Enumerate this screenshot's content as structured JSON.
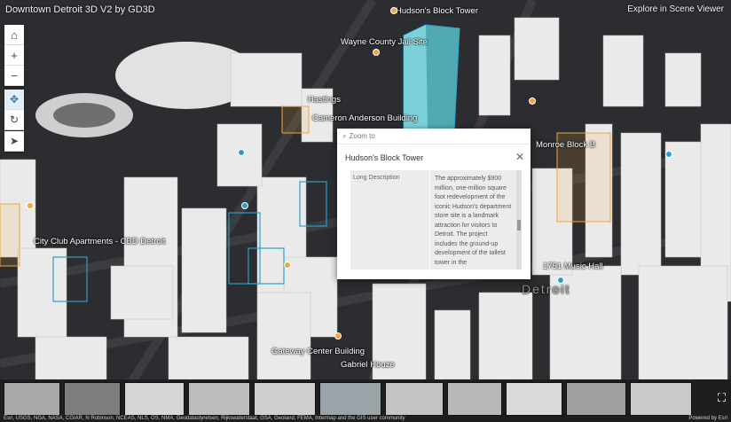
{
  "app": {
    "title": "Downtown Detroit 3D V2 by GD3D",
    "explore_link": "Explore in Scene Viewer"
  },
  "navigation": {
    "home_icon": "home-icon",
    "zoom_in": "+",
    "zoom_out": "−",
    "pan_icon": "pan-icon",
    "rotate_icon": "rotate-icon",
    "compass_icon": "compass-icon"
  },
  "map_labels": {
    "l1": "Hudson's Block Tower",
    "l2": "Wayne County Jail Site",
    "l3": "Hastings",
    "l4": "Cameron Anderson Building",
    "l5": "City Club Apartments - CBD Detroit",
    "l6": "Gateway Center Building",
    "l7": "Gabriel Houze",
    "l8": "Monroe Block B",
    "l9": "1751 Music Hall",
    "l10": "Detroit"
  },
  "popup": {
    "zoom_to": "Zoom to",
    "title": "Hudson's Block Tower",
    "close_label": "✕",
    "field_name": "Long Description",
    "field_value": "The approximately $900 million, one-million square foot redevelopment of the iconic Hudson's department store site is a landmark attraction for visitors to Detroit. The project includes the ground-up development of the tallest tower in the"
  },
  "filmstrip": {
    "slide_count": 12,
    "expand_icon": "fullscreen-icon"
  },
  "footer": {
    "attribution": "Esri, USGS, NGA, NASA, CGIAR, N Robinson, NCEAS, NLS, OS, NMA, Geodatastyrelsen, Rijkswaterstaat, GSA, Geoland, FEMA, Intermap and the GIS user community",
    "powered_by": "Powered by Esri"
  },
  "colors": {
    "highlight_tower": "#5fd3df",
    "outline_blue": "#2aa0c8",
    "outline_orange": "#f0a63c",
    "ground": "#2b2d30",
    "building": "#e9e9e9"
  }
}
